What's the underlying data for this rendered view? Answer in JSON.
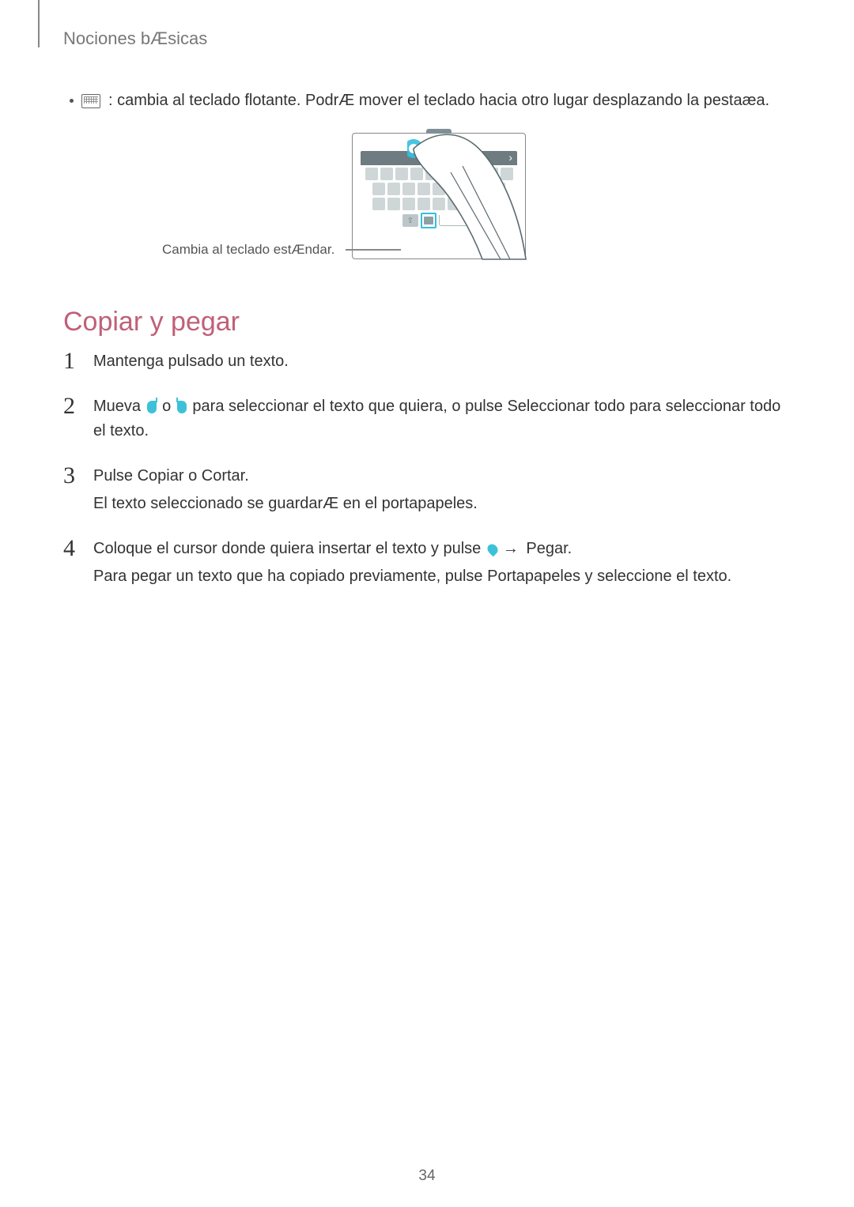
{
  "header": "Nociones bÆsicas",
  "bullet_text": " : cambia al teclado flotante. PodrÆ mover el teclado hacia otro lugar desplazando la pestaæa.",
  "callout": "Cambia al teclado estÆndar.",
  "section_title": "Copiar y pegar",
  "steps": {
    "s1": {
      "num": "1",
      "text": "Mantenga pulsado un texto."
    },
    "s2": {
      "num": "2",
      "pre": "Mueva ",
      "mid": " o ",
      "post": " para seleccionar el texto que quiera, o pulse ",
      "bold1": "Seleccionar todo",
      "tail": " para seleccionar todo el texto."
    },
    "s3": {
      "num": "3",
      "line1a": "Pulse ",
      "copy": "Copiar",
      "line1b": " o ",
      "cut": "Cortar",
      "line1c": ".",
      "line2": "El texto seleccionado se guardarÆ en el portapapeles."
    },
    "s4": {
      "num": "4",
      "line1a": "Coloque el cursor donde quiera insertar el texto y pulse ",
      "arrow": "→",
      "paste": " Pegar",
      "line1c": ".",
      "line2a": "Para pegar un texto que ha copiado previamente, pulse ",
      "clip": "Portapapeles",
      "line2b": " y seleccione el texto."
    }
  },
  "page_number": "34"
}
